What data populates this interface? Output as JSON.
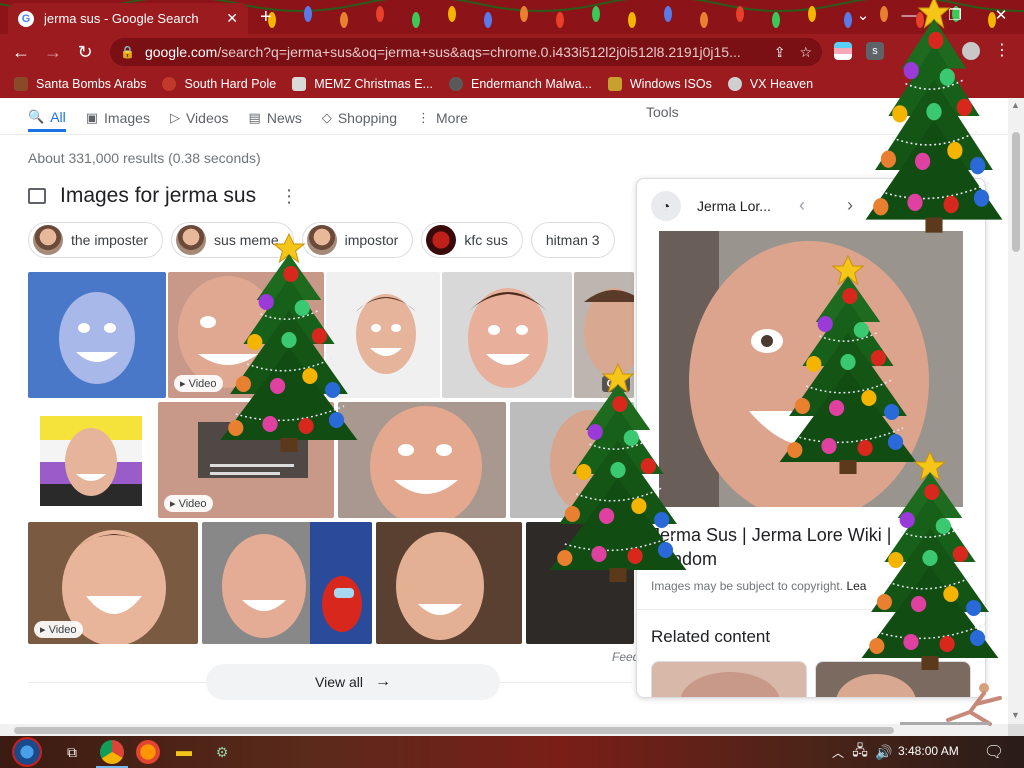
{
  "browser": {
    "tab_title": "jerma sus - Google Search",
    "tab_close": "✕",
    "new_tab": "+",
    "url_host": "google.com",
    "url_rest": "/search?q=jerma+sus&oq=jerma+sus&aqs=chrome.0.i433i512l2j0i512l8.2191j0j15...",
    "bookmarks": [
      {
        "label": "Santa Bombs Arabs",
        "color": "#8a4a2a"
      },
      {
        "label": "South Hard Pole",
        "color": "#c0392b"
      },
      {
        "label": "MEMZ Christmas E...",
        "color": "#d9d9d9"
      },
      {
        "label": "Endermanch Malwa...",
        "color": "#5a5a5a"
      },
      {
        "label": "Windows ISOs",
        "color": "#c8a030"
      },
      {
        "label": "VX Heaven",
        "color": "#cfcfcf"
      }
    ]
  },
  "search": {
    "tabs": [
      {
        "label": "All",
        "icon": "search-icon",
        "glyph": "🔍",
        "active": true
      },
      {
        "label": "Images",
        "icon": "image-icon",
        "glyph": "▣"
      },
      {
        "label": "Videos",
        "icon": "play-icon",
        "glyph": "▷"
      },
      {
        "label": "News",
        "icon": "news-icon",
        "glyph": "▤"
      },
      {
        "label": "Shopping",
        "icon": "tag-icon",
        "glyph": "◇"
      },
      {
        "label": "More",
        "icon": "more-vert-icon",
        "glyph": "⋮"
      }
    ],
    "tools": "Tools",
    "stats": "About 331,000 results (0.38 seconds)",
    "images_heading": "Images for jerma sus",
    "chips": [
      "the imposter",
      "sus meme",
      "impostor",
      "kfc sus",
      "hitman 3"
    ],
    "video_badge": "▸ Video",
    "gif_badge": "GIF",
    "view_all": "View all",
    "feedback": "Feed"
  },
  "panel": {
    "source": "Jerma Lor...",
    "title": "Jerma Sus | Jerma Lore Wiki | Fandom",
    "copyright": "Images may be subject to copyright.",
    "learn_more": "Lea",
    "related": "Related content"
  },
  "taskbar": {
    "clock": "3:48:00 AM"
  },
  "colors": {
    "chrome": "#9b1b1e",
    "tabbar": "#8c1418",
    "accent": "#1a73e8"
  }
}
